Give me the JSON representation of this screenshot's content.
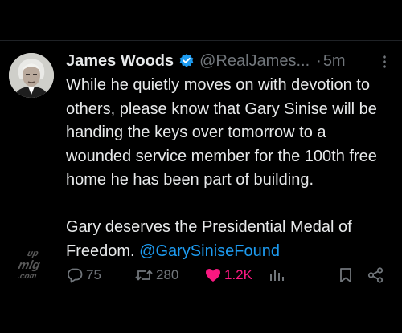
{
  "tweet": {
    "author_name": "James Woods",
    "handle": "@RealJames...",
    "separator": "·",
    "time": "5m",
    "text_para1": "While he quietly moves on with devotion to others, please know that Gary Sinise will be handing the keys over tomorrow to a wounded service member for the 100th free home he has been part of building.",
    "text_para2_prefix": "Gary deserves the Presidential Medal of Freedom. ",
    "text_para2_mention": "@GarySiniseFound",
    "watermark_text": "uploaded from mlgg.com"
  },
  "actions": {
    "replies": "75",
    "reposts": "280",
    "likes": "1.2K"
  },
  "colors": {
    "background": "#000000",
    "text": "#e7e9ea",
    "secondary": "#71767b",
    "link": "#1d9bf0",
    "like_active": "#f91880",
    "verified": "#1d9bf0"
  },
  "icons": [
    "avatar",
    "verified-badge-icon",
    "more-options-icon",
    "reply-icon",
    "repost-icon",
    "like-heart-icon",
    "views-icon",
    "bookmark-icon",
    "share-icon"
  ]
}
